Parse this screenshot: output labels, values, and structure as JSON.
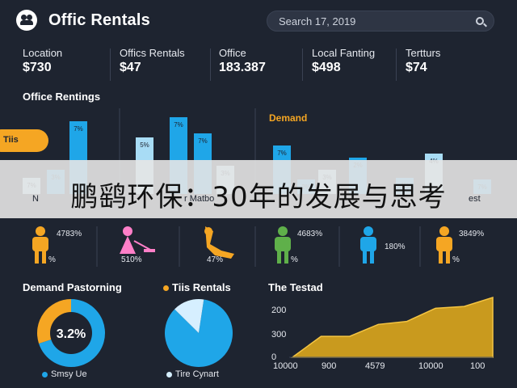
{
  "header": {
    "title": "Offic Rentals",
    "search_text": "Search 17, 2019"
  },
  "stats": [
    {
      "label": "Location",
      "value": "$730"
    },
    {
      "label": "Offics Rentals",
      "value": "$47"
    },
    {
      "label": "Office",
      "value": "183.387"
    },
    {
      "label": "Local Fanting",
      "value": "$498"
    },
    {
      "label": "Tertturs",
      "value": "$74"
    }
  ],
  "bar_section": {
    "title": "Office Rentings",
    "tooltip": "Tiis",
    "demand_label": "Demand",
    "partial_label_left": "N",
    "partial_label_mid": "r Matbo",
    "partial_label_right": "est"
  },
  "bars_chart_data": {
    "type": "bar",
    "bar_labels": [
      "7%",
      "3%",
      "7%",
      "5%",
      "7%",
      "7%",
      "3%",
      "7%",
      "2%",
      "3%",
      "2%",
      "4%",
      "4%",
      "7%",
      "3%"
    ],
    "values": [
      0.2,
      0.3,
      0.9,
      0.7,
      0.95,
      0.75,
      0.35,
      0.6,
      0.18,
      0.3,
      0.45,
      0.2,
      0.5,
      0.18,
      0.2
    ]
  },
  "banner": {
    "text": "鹏鹞环保：30年的发展与思考"
  },
  "people": [
    {
      "color": "#f5a623",
      "top": "4783%",
      "bottom": "%"
    },
    {
      "color": "#ff7fc8",
      "top": "",
      "bottom": "510%"
    },
    {
      "color": "#f5a623",
      "top": "",
      "bottom": "47%"
    },
    {
      "color": "#5fb04a",
      "top": "4683%",
      "bottom": "%"
    },
    {
      "color": "#1fa6e8",
      "top": "",
      "bottom": "180%"
    },
    {
      "color": "#f5a623",
      "top": "3849%",
      "bottom": "%"
    }
  ],
  "donut": {
    "title": "Demand Pastorning",
    "center_text": "3.2%",
    "legend": "Smsy Ue",
    "chart_data": {
      "type": "pie",
      "values": [
        70,
        30
      ],
      "colors": [
        "#1fa6e8",
        "#f5a623"
      ]
    }
  },
  "pie": {
    "title": "Tiis Rentals",
    "legend": "Tire Cynart",
    "chart_data": {
      "type": "pie",
      "values": [
        85,
        15
      ],
      "colors": [
        "#1fa6e8",
        "#d6efff"
      ]
    }
  },
  "area": {
    "title": "The Testad",
    "chart_data": {
      "type": "area",
      "y_ticks": [
        "200",
        "300",
        "0"
      ],
      "x_ticks": [
        "10000",
        "900",
        "4579",
        "10000",
        "100"
      ],
      "values": [
        0,
        0.35,
        0.35,
        0.55,
        0.6,
        0.82,
        0.85,
        1.0
      ],
      "fill": "#c99a1e",
      "stroke": "#f5c542"
    }
  },
  "colors": {
    "accent": "#f5a623",
    "blue": "#1fa6e8",
    "bg": "#1e2430"
  }
}
